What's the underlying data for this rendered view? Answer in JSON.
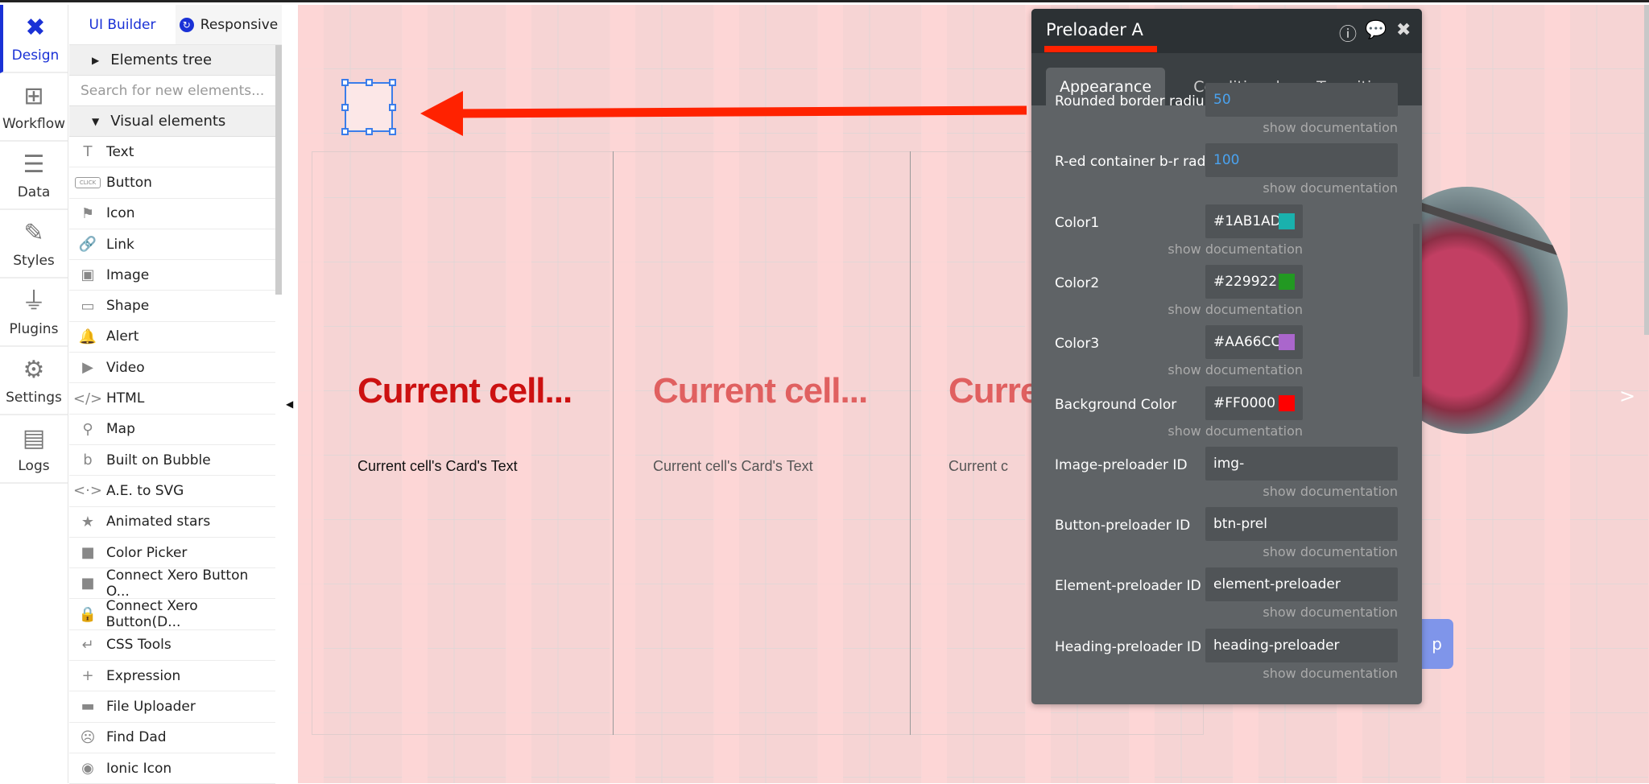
{
  "iconbar": {
    "items": [
      {
        "label": "Design",
        "icon": "design-icon"
      },
      {
        "label": "Workflow",
        "icon": "workflow-icon"
      },
      {
        "label": "Data",
        "icon": "database-icon"
      },
      {
        "label": "Styles",
        "icon": "brush-icon"
      },
      {
        "label": "Plugins",
        "icon": "plug-icon"
      },
      {
        "label": "Settings",
        "icon": "gear-icon"
      },
      {
        "label": "Logs",
        "icon": "document-icon"
      }
    ]
  },
  "panel": {
    "tabs": [
      "UI Builder",
      "Responsive"
    ],
    "elements_tree": "Elements tree",
    "search_placeholder": "Search for new elements...",
    "visual_elements": "Visual elements",
    "items": [
      {
        "label": "Text",
        "icon": "T"
      },
      {
        "label": "Button",
        "icon": "CLICK"
      },
      {
        "label": "Icon",
        "icon": "⚑"
      },
      {
        "label": "Link",
        "icon": "🔗"
      },
      {
        "label": "Image",
        "icon": "▣"
      },
      {
        "label": "Shape",
        "icon": "▭"
      },
      {
        "label": "Alert",
        "icon": "🔔"
      },
      {
        "label": "Video",
        "icon": "▶"
      },
      {
        "label": "HTML",
        "icon": "</>"
      },
      {
        "label": "Map",
        "icon": "⚲"
      },
      {
        "label": "Built on Bubble",
        "icon": "b"
      },
      {
        "label": "A.E. to SVG",
        "icon": "<·>"
      },
      {
        "label": "Animated stars",
        "icon": "★"
      },
      {
        "label": "Color Picker",
        "icon": "■"
      },
      {
        "label": "Connect Xero Button O...",
        "icon": "■"
      },
      {
        "label": "Connect Xero Button(D...",
        "icon": "🔒"
      },
      {
        "label": "CSS Tools",
        "icon": "↵"
      },
      {
        "label": "Expression",
        "icon": "+"
      },
      {
        "label": "File Uploader",
        "icon": "▬"
      },
      {
        "label": "Find Dad",
        "icon": "☹"
      },
      {
        "label": "Ionic Icon",
        "icon": "◉"
      }
    ]
  },
  "canvas": {
    "cells": [
      {
        "heading": "Current cell...",
        "text": "Current cell's Card's Text"
      },
      {
        "heading": "Current cell...",
        "text": "Current cell's Card's Text"
      },
      {
        "heading": "Curre",
        "text": "Current c"
      }
    ],
    "button_text": "p",
    "next": ">"
  },
  "property_editor": {
    "title": "Preloader A",
    "tabs": [
      "Appearance",
      "Conditional",
      "Transitions"
    ],
    "doc_link": "show documentation",
    "fields": [
      {
        "label": "Rounded border radiu",
        "value": "50",
        "type": "number"
      },
      {
        "label": "R-ed container b-r rad",
        "value": "100",
        "type": "number"
      },
      {
        "label": "Color1",
        "value": "#1AB1AD",
        "type": "color",
        "swatch": "#1AB1AD"
      },
      {
        "label": "Color2",
        "value": "#229922",
        "type": "color",
        "swatch": "#229922"
      },
      {
        "label": "Color3",
        "value": "#AA66CC",
        "type": "color",
        "swatch": "#AA66CC"
      },
      {
        "label": "Background Color",
        "value": "#FF0000",
        "type": "color",
        "swatch": "#FF0000"
      },
      {
        "label": "Image-preloader ID",
        "value": "img-",
        "type": "text"
      },
      {
        "label": "Button-preloader ID",
        "value": "btn-prel",
        "type": "text"
      },
      {
        "label": "Element-preloader ID",
        "value": "element-preloader",
        "type": "text"
      },
      {
        "label": "Heading-preloader ID",
        "value": "heading-preloader",
        "type": "text"
      }
    ]
  },
  "colors": {
    "accent": "#1a31d6",
    "annotation": "#ff2200",
    "heading_active": "#cc1111",
    "heading_faded": "#e06060"
  }
}
